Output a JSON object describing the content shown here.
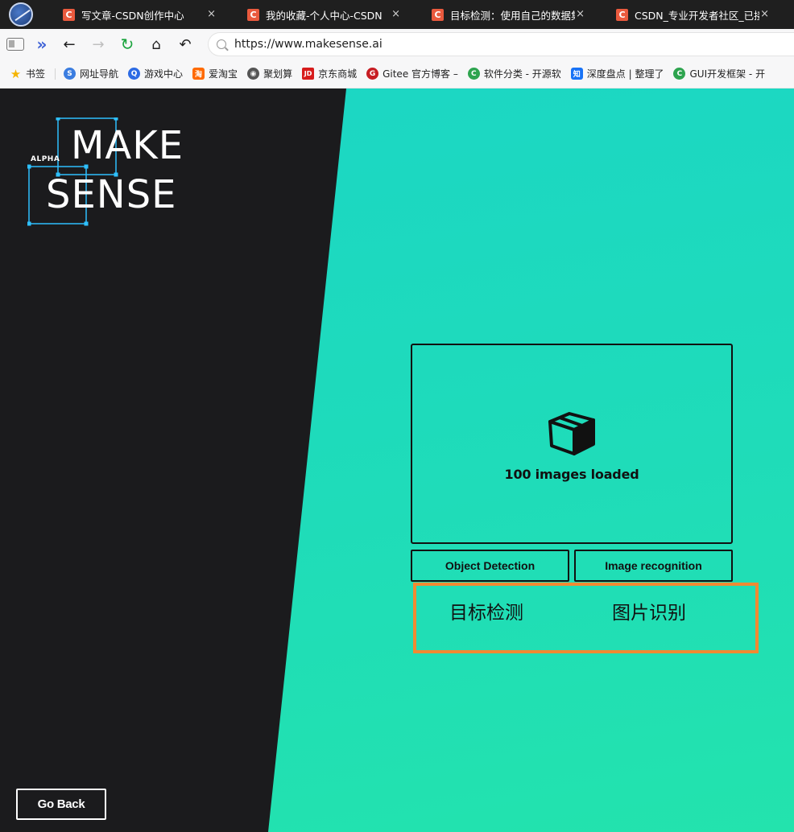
{
  "browser": {
    "tabs": [
      {
        "title": "写文章-CSDN创作中心",
        "icon_letter": "C"
      },
      {
        "title": "我的收藏-个人中心-CSDN",
        "icon_letter": "C"
      },
      {
        "title": "目标检测：使用自己的数据集做",
        "icon_letter": "C"
      },
      {
        "title": "CSDN_专业开发者社区_已接入",
        "icon_letter": "C"
      }
    ],
    "tab_close_glyph": "×",
    "url": "https://www.makesense.ai",
    "bookmarks": [
      {
        "label": "书签",
        "icon": "star-icon",
        "color": "#f5b400"
      },
      {
        "label": "网址导航",
        "icon": "nav-icon",
        "color": "#3b7de0"
      },
      {
        "label": "游戏中心",
        "icon": "game-icon",
        "color": "#2d6be4"
      },
      {
        "label": "爱淘宝",
        "icon": "taobao-icon",
        "color": "#ff6a00",
        "letter": "淘"
      },
      {
        "label": "聚划算",
        "icon": "globe-icon",
        "color": "#555555"
      },
      {
        "label": "京东商城",
        "icon": "jd-icon",
        "color": "#d71c1c",
        "letter": "JD"
      },
      {
        "label": "Gitee 官方博客 –",
        "icon": "gitee-icon",
        "color": "#c71d23",
        "letter": "G"
      },
      {
        "label": "软件分类 - 开源软",
        "icon": "oschina-icon",
        "color": "#2ea44f",
        "letter": "C"
      },
      {
        "label": "深度盘点 | 整理了",
        "icon": "zhihu-icon",
        "color": "#1772f6",
        "letter": "知"
      },
      {
        "label": "GUI开发框架 - 开",
        "icon": "oschina-icon",
        "color": "#2ea44f",
        "letter": "C"
      }
    ]
  },
  "app": {
    "logo": {
      "line1": "MAKE",
      "line2": "SENSE",
      "tag": "ALPHA"
    },
    "dropzone": {
      "status": "100 images loaded",
      "icon": "box-icon"
    },
    "buttons": {
      "object_detection": "Object Detection",
      "image_recognition": "Image recognition",
      "go_back": "Go Back"
    },
    "annotation": {
      "label_1": "目标检测",
      "label_2": "图片识别",
      "color": "#f08a32"
    },
    "colors": {
      "teal": "#1fdcb9",
      "dark": "#1b1b1d",
      "accent_blue": "#2ec0ff"
    }
  }
}
